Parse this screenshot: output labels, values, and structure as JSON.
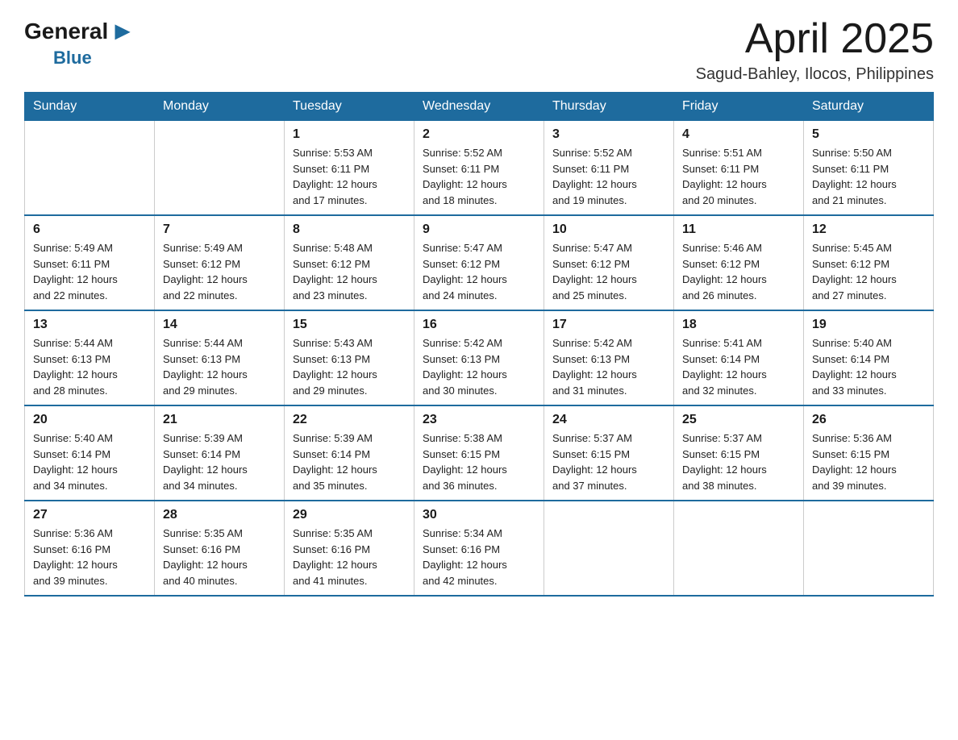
{
  "logo": {
    "general": "General",
    "arrow": "▶",
    "blue": "Blue"
  },
  "header": {
    "month_title": "April 2025",
    "subtitle": "Sagud-Bahley, Ilocos, Philippines"
  },
  "columns": [
    "Sunday",
    "Monday",
    "Tuesday",
    "Wednesday",
    "Thursday",
    "Friday",
    "Saturday"
  ],
  "weeks": [
    [
      {
        "day": "",
        "info": ""
      },
      {
        "day": "",
        "info": ""
      },
      {
        "day": "1",
        "info": "Sunrise: 5:53 AM\nSunset: 6:11 PM\nDaylight: 12 hours\nand 17 minutes."
      },
      {
        "day": "2",
        "info": "Sunrise: 5:52 AM\nSunset: 6:11 PM\nDaylight: 12 hours\nand 18 minutes."
      },
      {
        "day": "3",
        "info": "Sunrise: 5:52 AM\nSunset: 6:11 PM\nDaylight: 12 hours\nand 19 minutes."
      },
      {
        "day": "4",
        "info": "Sunrise: 5:51 AM\nSunset: 6:11 PM\nDaylight: 12 hours\nand 20 minutes."
      },
      {
        "day": "5",
        "info": "Sunrise: 5:50 AM\nSunset: 6:11 PM\nDaylight: 12 hours\nand 21 minutes."
      }
    ],
    [
      {
        "day": "6",
        "info": "Sunrise: 5:49 AM\nSunset: 6:11 PM\nDaylight: 12 hours\nand 22 minutes."
      },
      {
        "day": "7",
        "info": "Sunrise: 5:49 AM\nSunset: 6:12 PM\nDaylight: 12 hours\nand 22 minutes."
      },
      {
        "day": "8",
        "info": "Sunrise: 5:48 AM\nSunset: 6:12 PM\nDaylight: 12 hours\nand 23 minutes."
      },
      {
        "day": "9",
        "info": "Sunrise: 5:47 AM\nSunset: 6:12 PM\nDaylight: 12 hours\nand 24 minutes."
      },
      {
        "day": "10",
        "info": "Sunrise: 5:47 AM\nSunset: 6:12 PM\nDaylight: 12 hours\nand 25 minutes."
      },
      {
        "day": "11",
        "info": "Sunrise: 5:46 AM\nSunset: 6:12 PM\nDaylight: 12 hours\nand 26 minutes."
      },
      {
        "day": "12",
        "info": "Sunrise: 5:45 AM\nSunset: 6:12 PM\nDaylight: 12 hours\nand 27 minutes."
      }
    ],
    [
      {
        "day": "13",
        "info": "Sunrise: 5:44 AM\nSunset: 6:13 PM\nDaylight: 12 hours\nand 28 minutes."
      },
      {
        "day": "14",
        "info": "Sunrise: 5:44 AM\nSunset: 6:13 PM\nDaylight: 12 hours\nand 29 minutes."
      },
      {
        "day": "15",
        "info": "Sunrise: 5:43 AM\nSunset: 6:13 PM\nDaylight: 12 hours\nand 29 minutes."
      },
      {
        "day": "16",
        "info": "Sunrise: 5:42 AM\nSunset: 6:13 PM\nDaylight: 12 hours\nand 30 minutes."
      },
      {
        "day": "17",
        "info": "Sunrise: 5:42 AM\nSunset: 6:13 PM\nDaylight: 12 hours\nand 31 minutes."
      },
      {
        "day": "18",
        "info": "Sunrise: 5:41 AM\nSunset: 6:14 PM\nDaylight: 12 hours\nand 32 minutes."
      },
      {
        "day": "19",
        "info": "Sunrise: 5:40 AM\nSunset: 6:14 PM\nDaylight: 12 hours\nand 33 minutes."
      }
    ],
    [
      {
        "day": "20",
        "info": "Sunrise: 5:40 AM\nSunset: 6:14 PM\nDaylight: 12 hours\nand 34 minutes."
      },
      {
        "day": "21",
        "info": "Sunrise: 5:39 AM\nSunset: 6:14 PM\nDaylight: 12 hours\nand 34 minutes."
      },
      {
        "day": "22",
        "info": "Sunrise: 5:39 AM\nSunset: 6:14 PM\nDaylight: 12 hours\nand 35 minutes."
      },
      {
        "day": "23",
        "info": "Sunrise: 5:38 AM\nSunset: 6:15 PM\nDaylight: 12 hours\nand 36 minutes."
      },
      {
        "day": "24",
        "info": "Sunrise: 5:37 AM\nSunset: 6:15 PM\nDaylight: 12 hours\nand 37 minutes."
      },
      {
        "day": "25",
        "info": "Sunrise: 5:37 AM\nSunset: 6:15 PM\nDaylight: 12 hours\nand 38 minutes."
      },
      {
        "day": "26",
        "info": "Sunrise: 5:36 AM\nSunset: 6:15 PM\nDaylight: 12 hours\nand 39 minutes."
      }
    ],
    [
      {
        "day": "27",
        "info": "Sunrise: 5:36 AM\nSunset: 6:16 PM\nDaylight: 12 hours\nand 39 minutes."
      },
      {
        "day": "28",
        "info": "Sunrise: 5:35 AM\nSunset: 6:16 PM\nDaylight: 12 hours\nand 40 minutes."
      },
      {
        "day": "29",
        "info": "Sunrise: 5:35 AM\nSunset: 6:16 PM\nDaylight: 12 hours\nand 41 minutes."
      },
      {
        "day": "30",
        "info": "Sunrise: 5:34 AM\nSunset: 6:16 PM\nDaylight: 12 hours\nand 42 minutes."
      },
      {
        "day": "",
        "info": ""
      },
      {
        "day": "",
        "info": ""
      },
      {
        "day": "",
        "info": ""
      }
    ]
  ]
}
